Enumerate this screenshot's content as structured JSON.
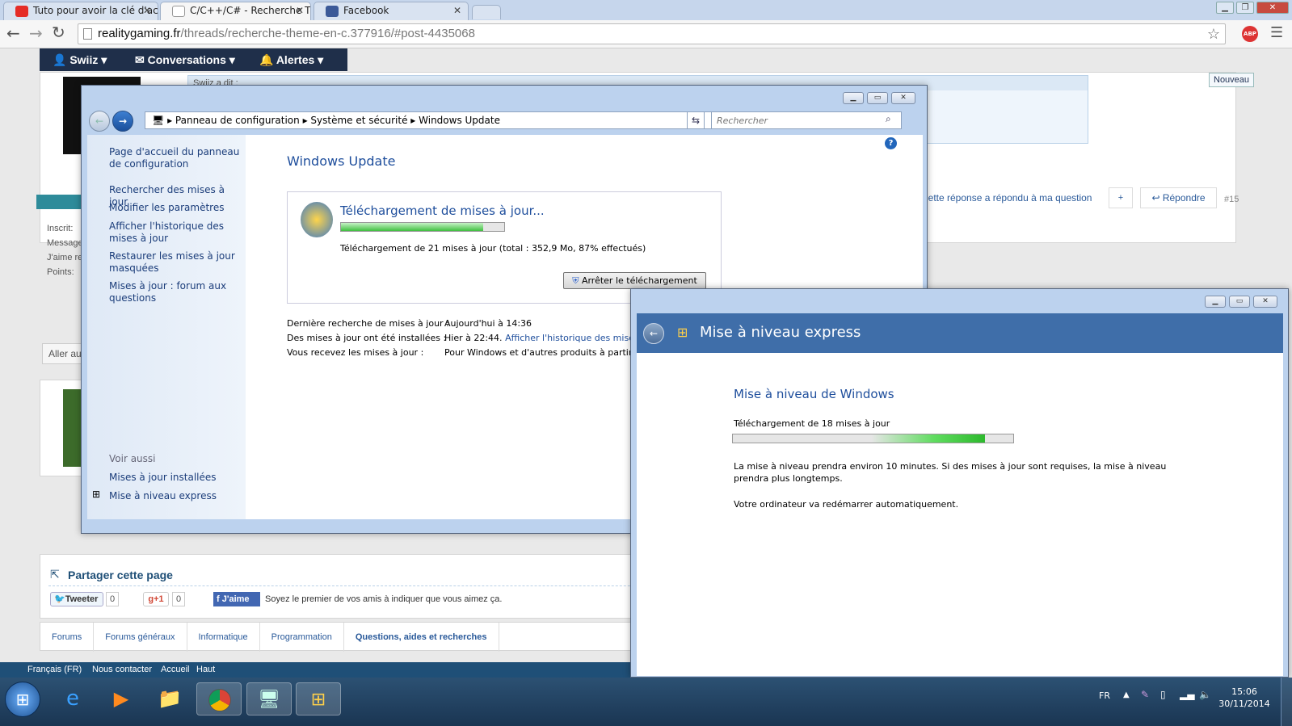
{
  "browser": {
    "tabs": [
      {
        "title": "Tuto pour avoir la clé d'ac"
      },
      {
        "title": "C/C++/C# - Recherche Th"
      },
      {
        "title": "Facebook"
      }
    ],
    "url_host": "realitygaming.fr",
    "url_path": "/threads/recherche-theme-en-c.377916/#post-4435068",
    "adblock_badge": "ABP"
  },
  "site": {
    "nav": {
      "user": "Swiiz",
      "conversations": "Conversations",
      "alerts": "Alertes"
    },
    "quote_header": "Swiiz a dit :",
    "new_badge": "Nouveau",
    "post_actions": {
      "answered": "Cette réponse a répondu à ma question",
      "plus": "+",
      "reply": "Répondre",
      "post_number": "#15"
    },
    "profile_labels": [
      "Inscrit:",
      "Messages:",
      "J'aime reçus:",
      "Points:"
    ],
    "goto_button": "Aller au",
    "share": {
      "title": "Partager cette page",
      "tweet": "Tweeter",
      "tweet_count": "0",
      "gplus": "g+1",
      "gplus_count": "0",
      "fb_like": "J'aime",
      "fb_text": "Soyez le premier de vos amis à indiquer que vous aimez ça."
    },
    "breadcrumbs": [
      "Forums",
      "Forums généraux",
      "Informatique",
      "Programmation",
      "Questions, aides et recherches"
    ],
    "footer_links": [
      "Français (FR)",
      "Nous contacter",
      "Accueil",
      "Haut"
    ]
  },
  "control_panel": {
    "address": [
      "Panneau de configuration",
      "Système et sécurité",
      "Windows Update"
    ],
    "search_placeholder": "Rechercher",
    "sidebar": {
      "home": "Page d'accueil du panneau de configuration",
      "links": [
        "Rechercher des mises à jour",
        "Modifier les paramètres",
        "Afficher l'historique des mises à jour",
        "Restaurer les mises à jour masquées",
        "Mises à jour : forum aux questions"
      ],
      "see_also": "Voir aussi",
      "also_links": [
        "Mises à jour installées",
        "Mise à niveau express"
      ]
    },
    "title": "Windows Update",
    "download": {
      "heading": "Téléchargement de mises à jour...",
      "status": "Téléchargement de 21 mises à jour (total : 352,9 Mo, 87% effectués)",
      "progress": 0.87,
      "stop_button": "Arrêter le téléchargement"
    },
    "info": [
      {
        "label": "Dernière recherche de mises à jour :",
        "value": "Aujourd'hui à 14:36",
        "link": ""
      },
      {
        "label": "Des mises à jour ont été installées :",
        "value": "Hier à 22:44.",
        "link": "Afficher l'historique des mises à"
      },
      {
        "label": "Vous recevez les mises à jour :",
        "value": "Pour Windows et d'autres produits à partir de",
        "link": ""
      }
    ]
  },
  "express": {
    "title": "Mise à niveau express",
    "heading": "Mise à niveau de Windows",
    "status": "Téléchargement de 18 mises à jour",
    "progress": 0.9,
    "note1": "La mise à niveau prendra environ 10 minutes. Si des mises à jour sont requises, la mise à niveau prendra plus longtemps.",
    "note2": "Votre ordinateur va redémarrer automatiquement."
  },
  "taskbar": {
    "lang": "FR",
    "time": "15:06",
    "date": "30/11/2014"
  }
}
